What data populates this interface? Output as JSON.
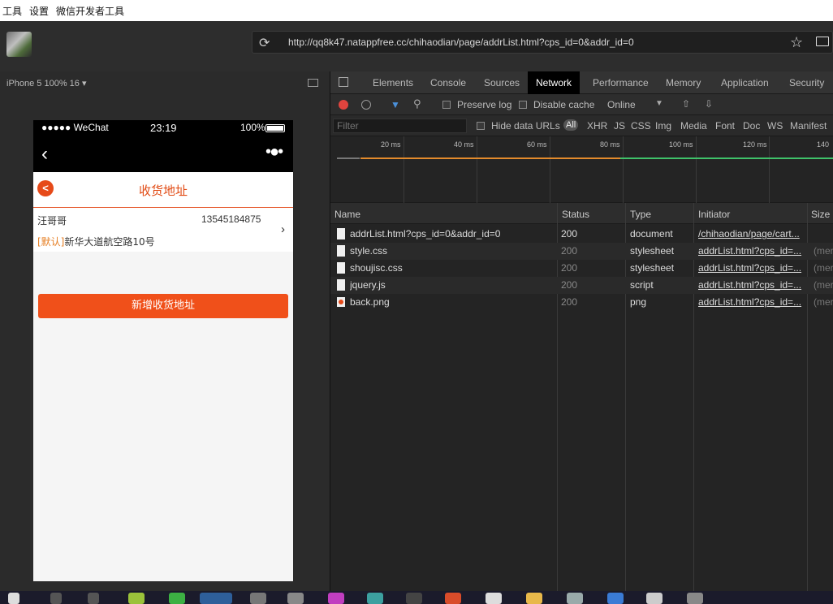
{
  "menubar": {
    "items": [
      "工具",
      "设置",
      "微信开发者工具"
    ]
  },
  "address": {
    "url": "http://qq8k47.natappfree.cc/chihaodian/page/addrList.html?cps_id=0&addr_id=0"
  },
  "simulator": {
    "device": "iPhone 5 100% 16 ▾",
    "statusbar": {
      "carrier": "●●●●● WeChat",
      "time": "23:19",
      "battery": "100%"
    },
    "page_title": "收货地址",
    "address": {
      "name": "汪哥哥",
      "phone": "13545184875",
      "tag": "[默认]",
      "detail": "新华大道航空路10号"
    },
    "add_button": "新增收货地址"
  },
  "devtools": {
    "tabs": [
      "Elements",
      "Console",
      "Sources",
      "Network",
      "Performance",
      "Memory",
      "Application",
      "Security"
    ],
    "active_tab": "Network",
    "toolbar": {
      "preserve_log": "Preserve log",
      "disable_cache": "Disable cache",
      "throttle": "Online"
    },
    "filter": {
      "placeholder": "Filter",
      "hide_data_urls": "Hide data URLs",
      "types": [
        "All",
        "XHR",
        "JS",
        "CSS",
        "Img",
        "Media",
        "Font",
        "Doc",
        "WS",
        "Manifest"
      ]
    },
    "timeline_ticks": [
      "20 ms",
      "40 ms",
      "60 ms",
      "80 ms",
      "100 ms",
      "120 ms",
      "140"
    ],
    "columns": [
      "Name",
      "Status",
      "Type",
      "Initiator",
      "Size"
    ],
    "rows": [
      {
        "name": "addrList.html?cps_id=0&addr_id=0",
        "status": "200",
        "type": "document",
        "initiator": "/chihaodian/page/cart...",
        "size": ""
      },
      {
        "name": "style.css",
        "status": "200",
        "type": "stylesheet",
        "initiator": "addrList.html?cps_id=...",
        "size": "(mer"
      },
      {
        "name": "shoujisc.css",
        "status": "200",
        "type": "stylesheet",
        "initiator": "addrList.html?cps_id=...",
        "size": "(mer"
      },
      {
        "name": "jquery.js",
        "status": "200",
        "type": "script",
        "initiator": "addrList.html?cps_id=...",
        "size": "(mer"
      },
      {
        "name": "back.png",
        "status": "200",
        "type": "png",
        "initiator": "addrList.html?cps_id=...",
        "size": "(mer"
      }
    ]
  }
}
